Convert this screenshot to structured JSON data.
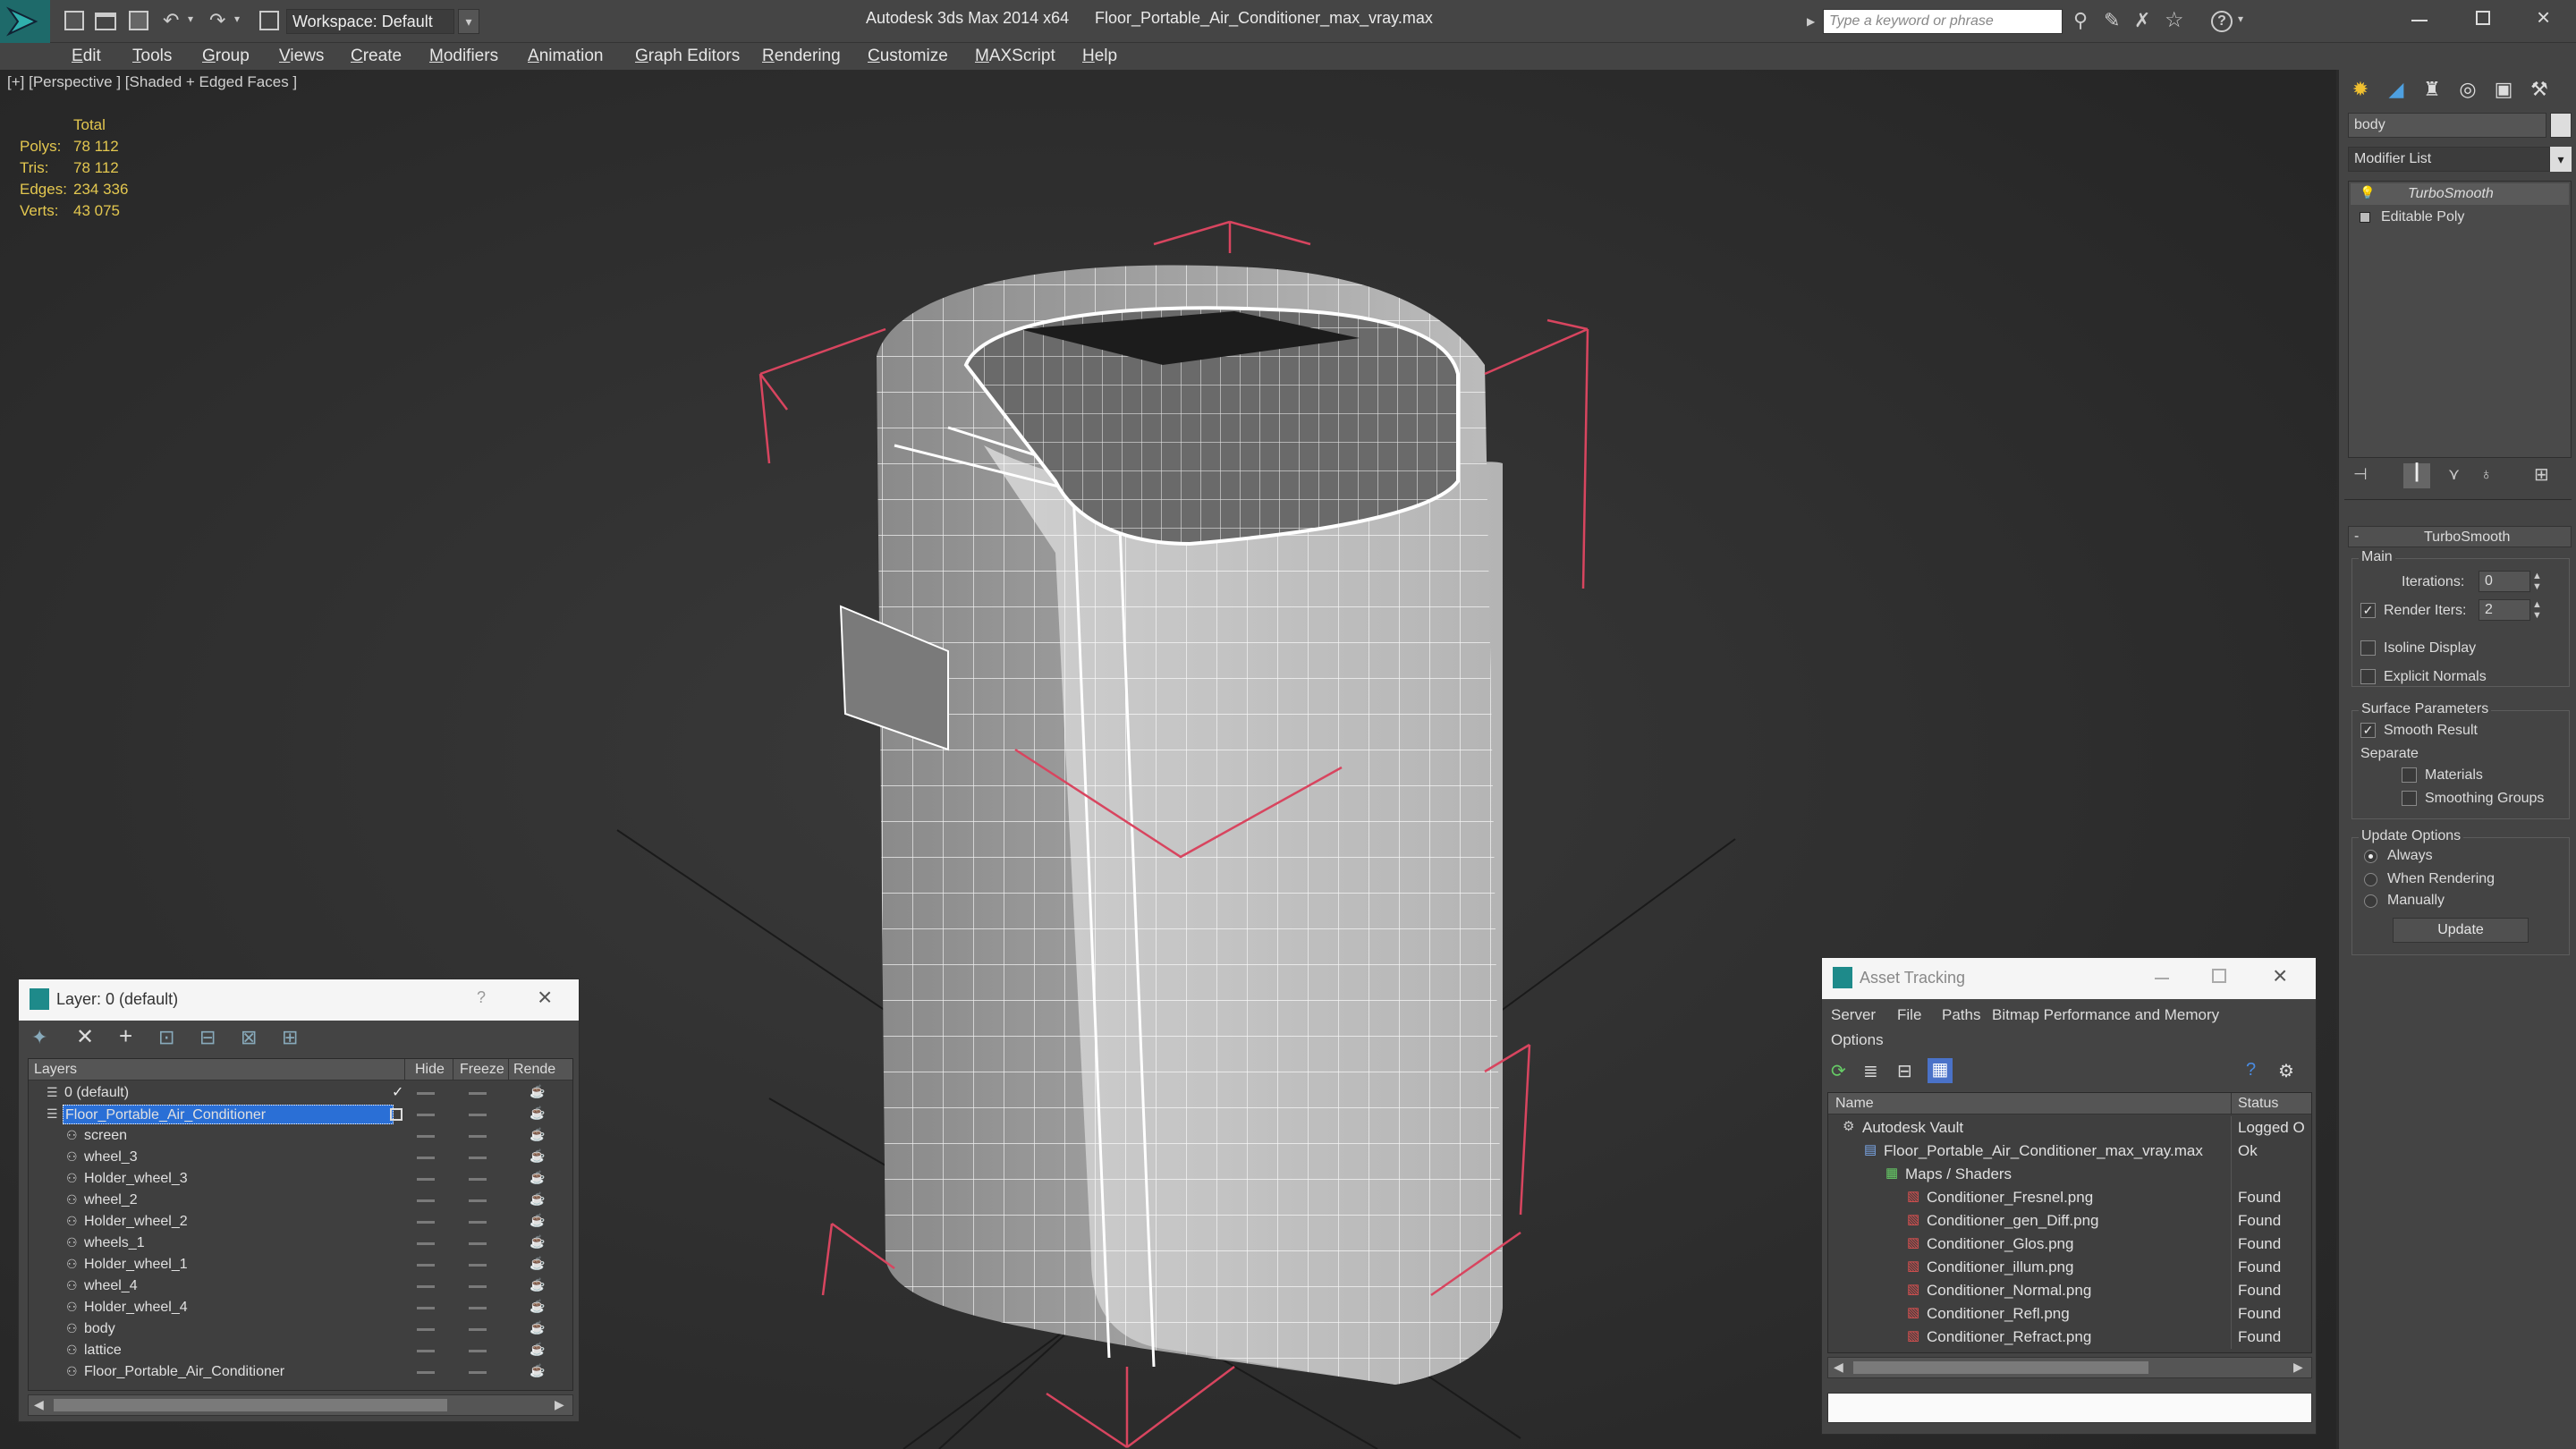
{
  "titlebar": {
    "workspace": "Workspace: Default",
    "app_title": "Autodesk 3ds Max  2014 x64",
    "file_title": "Floor_Portable_Air_Conditioner_max_vray.max",
    "search_placeholder": "Type a keyword or phrase"
  },
  "menu": [
    "Edit",
    "Tools",
    "Group",
    "Views",
    "Create",
    "Modifiers",
    "Animation",
    "Graph Editors",
    "Rendering",
    "Customize",
    "MAXScript",
    "Help"
  ],
  "viewport": {
    "label": "[+] [Perspective ] [Shaded + Edged Faces ]",
    "stats_header": "Total",
    "stats": [
      {
        "label": "Polys:",
        "value": "78 112"
      },
      {
        "label": "Tris:",
        "value": "78 112"
      },
      {
        "label": "Edges:",
        "value": "234 336"
      },
      {
        "label": "Verts:",
        "value": "43 075"
      }
    ]
  },
  "command_panel": {
    "object_name": "body",
    "modifier_list": "Modifier List",
    "stack": [
      "TurboSmooth",
      "Editable Poly"
    ],
    "rollout_title": "TurboSmooth",
    "main_group": "Main",
    "iterations_label": "Iterations:",
    "iterations_value": "0",
    "render_iters_label": "Render Iters:",
    "render_iters_value": "2",
    "render_iters_checked": true,
    "isoline_label": "Isoline Display",
    "explicit_normals_label": "Explicit Normals",
    "surface_group": "Surface Parameters",
    "smooth_result_label": "Smooth Result",
    "separate_label": "Separate",
    "materials_label": "Materials",
    "smoothing_groups_label": "Smoothing Groups",
    "update_group": "Update Options",
    "update_options": [
      "Always",
      "When Rendering",
      "Manually"
    ],
    "update_selected": "Always",
    "update_button": "Update"
  },
  "layer_window": {
    "title": "Layer: 0 (default)",
    "help": "?",
    "columns": [
      "Layers",
      "Hide",
      "Freeze",
      "Rende"
    ],
    "rows": [
      {
        "name": "0 (default)",
        "level": 0,
        "type": "layer"
      },
      {
        "name": "Floor_Portable_Air_Conditioner",
        "level": 0,
        "type": "layer",
        "selected": true
      },
      {
        "name": "screen",
        "level": 1,
        "type": "object"
      },
      {
        "name": "wheel_3",
        "level": 1,
        "type": "object"
      },
      {
        "name": "Holder_wheel_3",
        "level": 1,
        "type": "object"
      },
      {
        "name": "wheel_2",
        "level": 1,
        "type": "object"
      },
      {
        "name": "Holder_wheel_2",
        "level": 1,
        "type": "object"
      },
      {
        "name": "wheels_1",
        "level": 1,
        "type": "object"
      },
      {
        "name": "Holder_wheel_1",
        "level": 1,
        "type": "object"
      },
      {
        "name": "wheel_4",
        "level": 1,
        "type": "object"
      },
      {
        "name": "Holder_wheel_4",
        "level": 1,
        "type": "object"
      },
      {
        "name": "body",
        "level": 1,
        "type": "object"
      },
      {
        "name": "lattice",
        "level": 1,
        "type": "object"
      },
      {
        "name": "Floor_Portable_Air_Conditioner",
        "level": 1,
        "type": "object"
      }
    ]
  },
  "asset_window": {
    "title": "Asset Tracking",
    "menu": [
      "Server",
      "File",
      "Paths",
      "Bitmap Performance and Memory",
      "Options"
    ],
    "columns": [
      "Name",
      "Status"
    ],
    "rows": [
      {
        "name": "Autodesk Vault",
        "status": "Logged O",
        "level": 0
      },
      {
        "name": "Floor_Portable_Air_Conditioner_max_vray.max",
        "status": "Ok",
        "level": 1
      },
      {
        "name": "Maps / Shaders",
        "status": "",
        "level": 2
      },
      {
        "name": "Conditioner_Fresnel.png",
        "status": "Found",
        "level": 3
      },
      {
        "name": "Conditioner_gen_Diff.png",
        "status": "Found",
        "level": 3
      },
      {
        "name": "Conditioner_Glos.png",
        "status": "Found",
        "level": 3
      },
      {
        "name": "Conditioner_illum.png",
        "status": "Found",
        "level": 3
      },
      {
        "name": "Conditioner_Normal.png",
        "status": "Found",
        "level": 3
      },
      {
        "name": "Conditioner_Refl.png",
        "status": "Found",
        "level": 3
      },
      {
        "name": "Conditioner_Refract.png",
        "status": "Found",
        "level": 3
      }
    ]
  },
  "colors": {
    "stats_yellow": "#e3c74f",
    "selection_blue": "#2a6fd6",
    "bbox_red": "#d8455f"
  }
}
